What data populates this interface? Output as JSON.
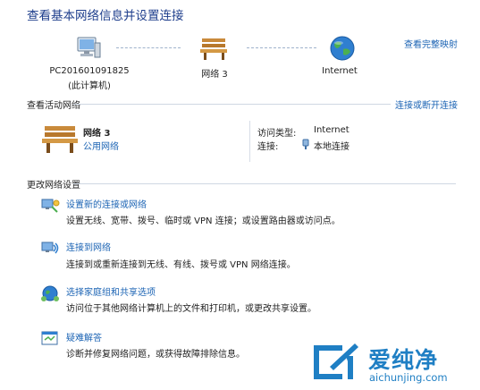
{
  "header": {
    "title": "查看基本网络信息并设置连接",
    "see_full_map": "查看完整映射"
  },
  "network_map": {
    "computer": {
      "name": "PC201601091825",
      "sub": "(此计算机)",
      "icon": "computer-icon"
    },
    "network": {
      "name": "网络  3",
      "icon": "bench-icon"
    },
    "internet": {
      "name": "Internet",
      "icon": "globe-icon"
    }
  },
  "active_networks": {
    "title": "查看活动网络",
    "connect_link": "连接或断开连接",
    "network_name": "网络  3",
    "network_type": "公用网络",
    "access_type_label": "访问类型:",
    "access_type_value": "Internet",
    "connection_label": "连接:",
    "connection_value": "本地连接"
  },
  "settings": {
    "title": "更改网络设置",
    "tasks": [
      {
        "title": "设置新的连接或网络",
        "desc": "设置无线、宽带、拨号、临时或 VPN 连接；或设置路由器或访问点。",
        "icon": "new-connection-icon"
      },
      {
        "title": "连接到网络",
        "desc": "连接到或重新连接到无线、有线、拨号或 VPN 网络连接。",
        "icon": "connect-network-icon"
      },
      {
        "title": "选择家庭组和共享选项",
        "desc": "访问位于其他网络计算机上的文件和打印机，或更改共享设置。",
        "icon": "homegroup-icon"
      },
      {
        "title": "疑难解答",
        "desc": "诊断并修复网络问题，或获得故障排除信息。",
        "icon": "troubleshoot-icon"
      }
    ]
  },
  "watermark": {
    "cn": "爱纯净",
    "url": "aichunjing.com"
  },
  "colors": {
    "title": "#1e3e8c",
    "link": "#1c64b4",
    "watermark": "#1f7fc4"
  }
}
